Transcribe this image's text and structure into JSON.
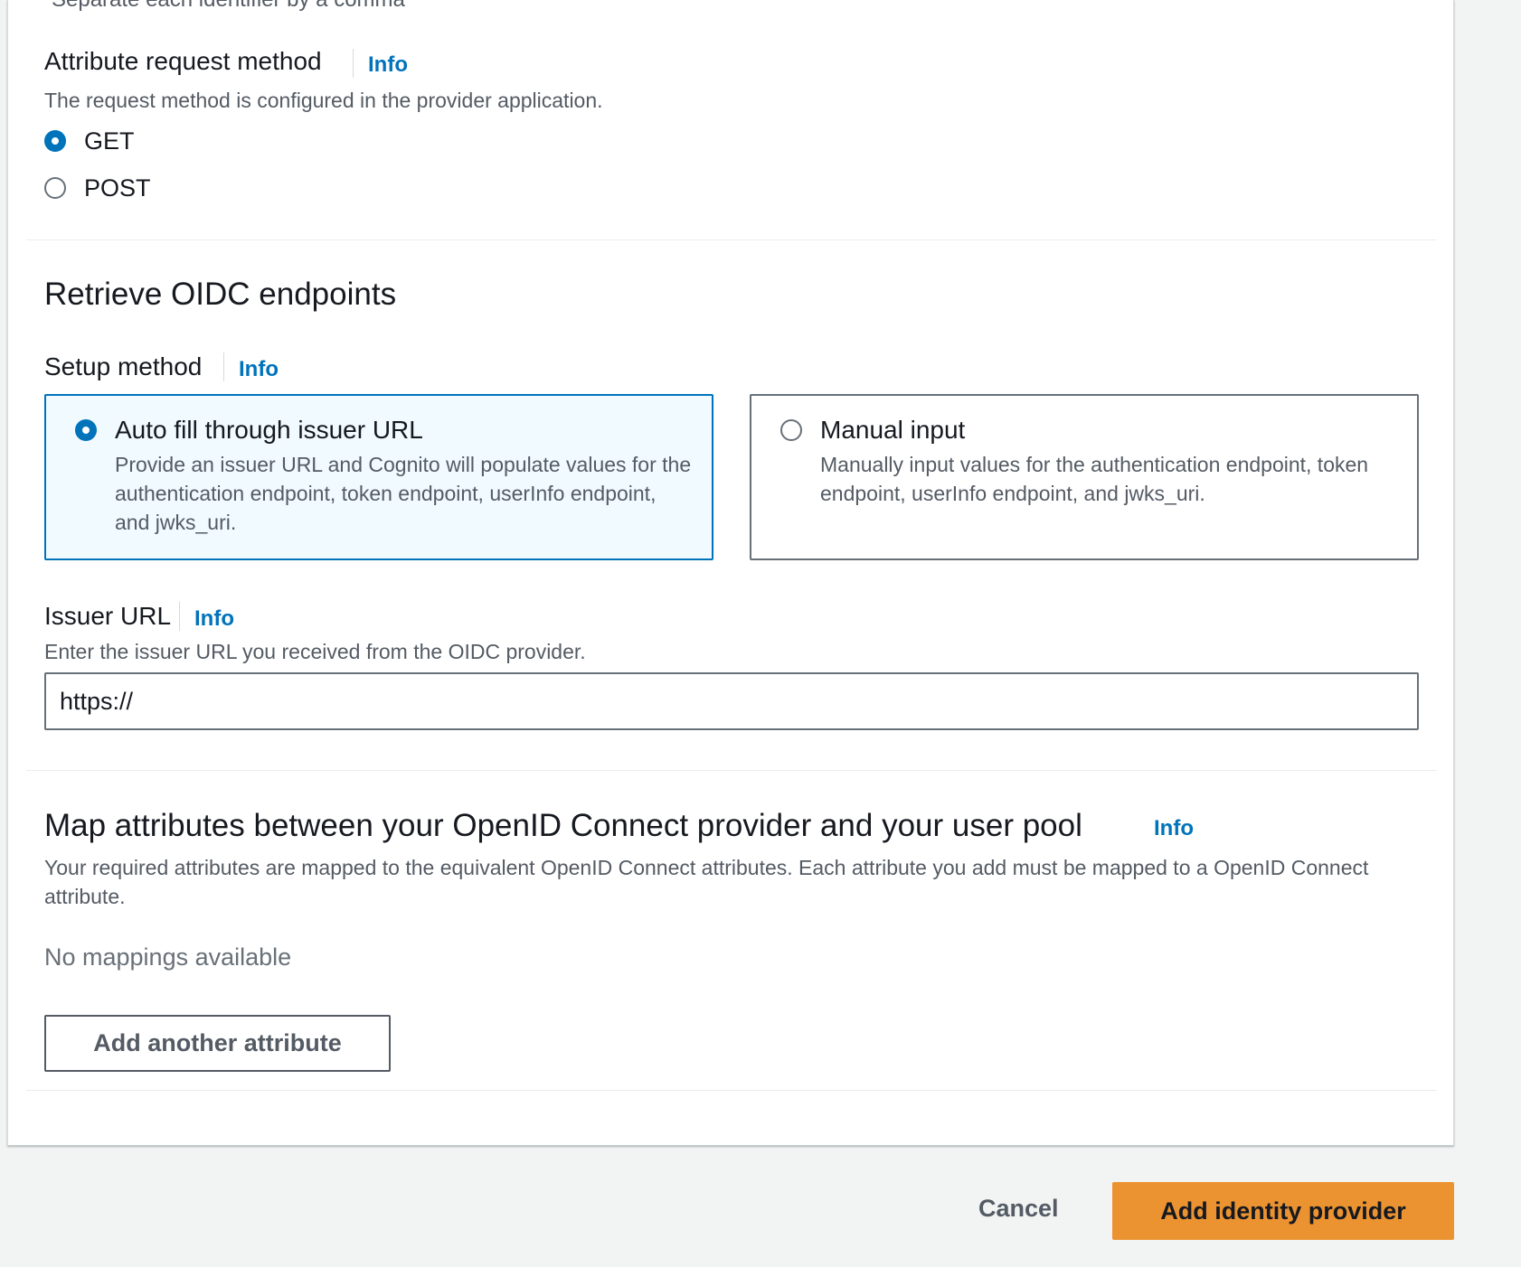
{
  "cutoff_text": "Separate each identifier by a comma",
  "attribute_request_method": {
    "label": "Attribute request method",
    "info": "Info",
    "description": "The request method is configured in the provider application.",
    "options": [
      {
        "label": "GET",
        "checked": true
      },
      {
        "label": "POST",
        "checked": false
      }
    ]
  },
  "oidc_endpoints": {
    "heading": "Retrieve OIDC endpoints",
    "setup_method": {
      "label": "Setup method",
      "info": "Info",
      "tiles": [
        {
          "title": "Auto fill through issuer URL",
          "description": "Provide an issuer URL and Cognito will populate values for the authentication endpoint, token endpoint, userInfo endpoint, and jwks_uri.",
          "selected": true
        },
        {
          "title": "Manual input",
          "description": "Manually input values for the authentication endpoint, token endpoint, userInfo endpoint, and jwks_uri.",
          "selected": false
        }
      ]
    },
    "issuer_url": {
      "label": "Issuer URL",
      "info": "Info",
      "description": "Enter the issuer URL you received from the OIDC provider.",
      "value": "https://"
    }
  },
  "map_attributes": {
    "heading": "Map attributes between your OpenID Connect provider and your user pool",
    "info": "Info",
    "description": "Your required attributes are mapped to the equivalent OpenID Connect attributes. Each attribute you add must be mapped to a OpenID Connect attribute.",
    "empty_text": "No mappings available",
    "add_button": "Add another attribute"
  },
  "footer": {
    "cancel": "Cancel",
    "submit": "Add identity provider"
  },
  "colors": {
    "accent": "#0073bb",
    "primary_button": "#ec9331",
    "page_background": "#f2f3f3"
  }
}
